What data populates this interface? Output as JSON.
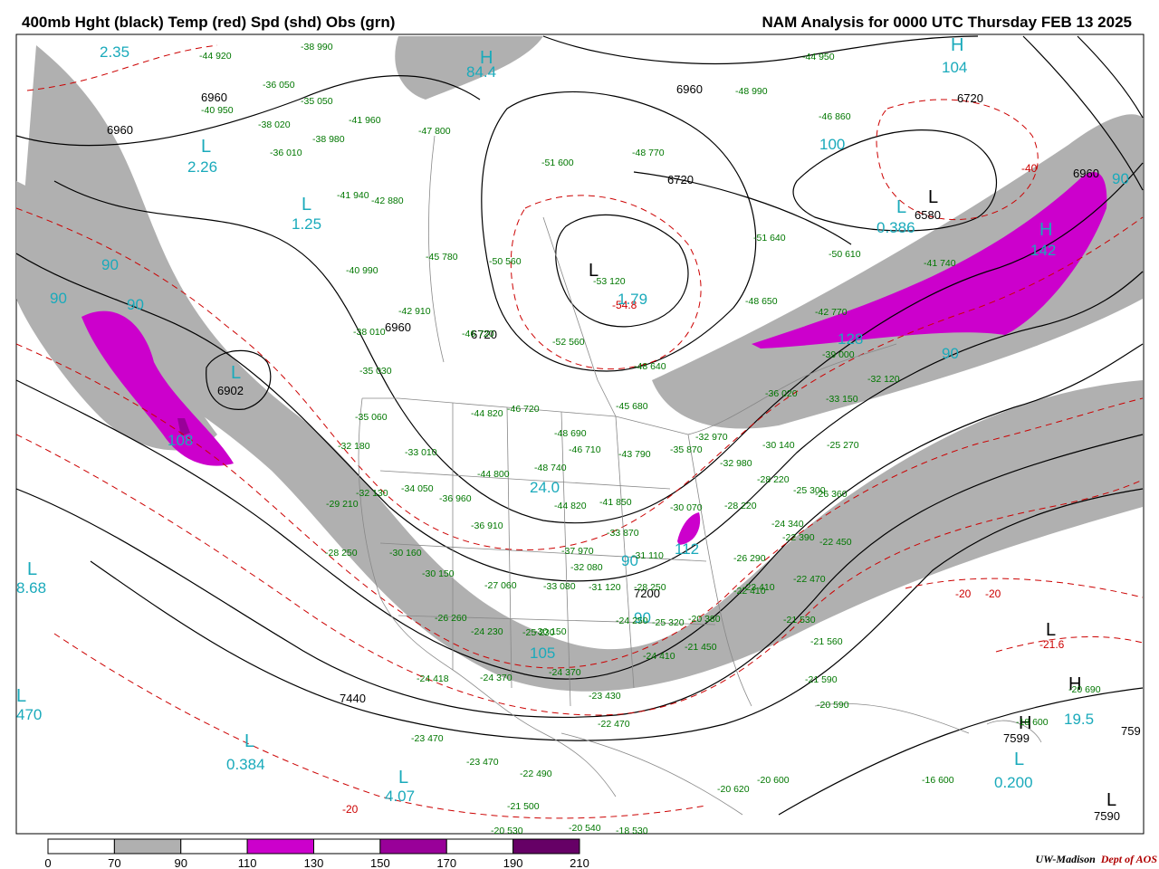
{
  "header": {
    "left_title": "400mb Hght (black) Temp (red) Spd (shd) Obs (grn)",
    "right_title": "NAM Analysis for 0000 UTC Thursday  FEB 13 2025"
  },
  "colors": {
    "height_contour": "#000000",
    "temp_contour": "#cc0000",
    "speed_70_90": "#b0b0b0",
    "speed_110_130": "#cc00cc",
    "speed_150_170": "#990099",
    "speed_190_210": "#660066",
    "isotach_label": "#1aaabb",
    "obs": "#007700",
    "borders": "#888888"
  },
  "height_labels": [
    "6960",
    "6960",
    "6960",
    "6720",
    "6720",
    "6960",
    "6580",
    "6902",
    "6960",
    "6720",
    "7200",
    "7440",
    "7599",
    "7590",
    "759"
  ],
  "temp_labels": [
    "-40",
    "-54.8",
    "-20",
    "-20",
    "-21.6",
    "-20"
  ],
  "isotach_labels": [
    "2.35",
    "84.4",
    "104",
    "100",
    "2.26",
    "1.25",
    "0.386",
    "142",
    "90",
    "90",
    "90",
    "90",
    "108",
    "1.79",
    "128",
    "90",
    "24.0",
    "112",
    "90",
    "90",
    "105",
    "8.68",
    "470",
    "0.384",
    "4.07",
    "0.200",
    "19.5"
  ],
  "pressure_centers": [
    "H",
    "H",
    "L",
    "L",
    "L",
    "L",
    "H",
    "L",
    "L",
    "L",
    "L",
    "L",
    "L",
    "L",
    "H",
    "H",
    "L",
    "L"
  ],
  "observations": [
    "-44 920",
    "-38 990",
    "-36 050",
    "-35 050",
    "-40 950",
    "-38 020",
    "-36 010",
    "-38 980",
    "-41 960",
    "-47 800",
    "-51 600",
    "-48 770",
    "-48 990",
    "-44 950",
    "-46 860",
    "-41 940",
    "-42 880",
    "-40 990",
    "-45 780",
    "-50 560",
    "-51 640",
    "-50 610",
    "-42 910",
    "-38 010",
    "-46 720",
    "-48 640",
    "-52 560",
    "-53 120",
    "-41 740",
    "-48 650",
    "-42 770",
    "-39 000",
    "-35 030",
    "-45 680",
    "-44 820",
    "-46 720",
    "-48 690",
    "-46 710",
    "-43 790",
    "-36 020",
    "-33 150",
    "-32 120",
    "-35 060",
    "-32 180",
    "-33 010",
    "-36 960",
    "-44 800",
    "-48 740",
    "-35 870",
    "-32 970",
    "-30 140",
    "-32 980",
    "-28 220",
    "-25 270",
    "-26 360",
    "-32 130",
    "-34 050",
    "-29 210",
    "-36 910",
    "-44 820",
    "-41 850",
    "-30 070",
    "-28 220",
    "-25 300",
    "-24 340",
    "-22 390",
    "-22 450",
    "-28 250",
    "-30 160",
    "-30 150",
    "-37 970",
    "-33 870",
    "-32 080",
    "-31 110",
    "-26 290",
    "-22 410",
    "-22 470",
    "-27 060",
    "-33 080",
    "-31 120",
    "-30 150",
    "-28 250",
    "-23 410",
    "-26 260",
    "-24 230",
    "-25 230",
    "-24 250",
    "-25 320",
    "-20 380",
    "-21 530",
    "-24 418",
    "-24 370",
    "-24 370",
    "-24 410",
    "-21 450",
    "-21 560",
    "-23 430",
    "-22 470",
    "-21 590",
    "-20 590",
    "-23 470",
    "-23 470",
    "-22 490",
    "-20 690",
    "-18 600",
    "-21 500",
    "-20 620",
    "-20 600",
    "-16 600",
    "-20 530",
    "-20 540",
    "-18 530"
  ],
  "colorbar": {
    "ticks": [
      "0",
      "70",
      "90",
      "110",
      "130",
      "150",
      "170",
      "190",
      "210"
    ],
    "fills": [
      "#ffffff",
      "#b0b0b0",
      "#ffffff",
      "#cc00cc",
      "#ffffff",
      "#990099",
      "#ffffff",
      "#660066"
    ]
  },
  "credit": {
    "institution": "UW-Madison",
    "dept": "Dept of AOS"
  }
}
